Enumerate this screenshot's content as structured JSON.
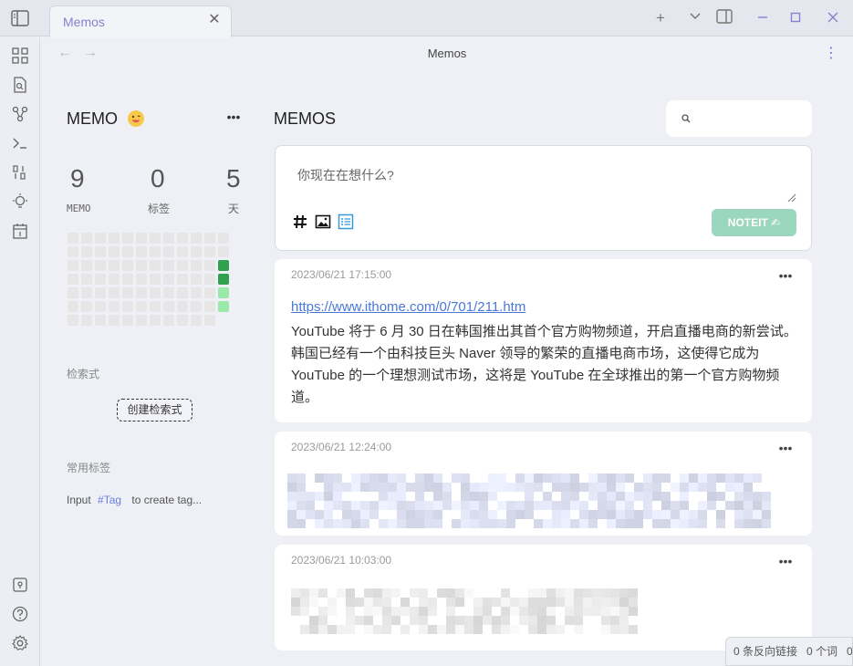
{
  "tab": {
    "title": "Memos",
    "close": "✕"
  },
  "window": {
    "new_tab": "+",
    "dropdown": "⌄",
    "minimize": "—",
    "maximize": "☐",
    "close": "✕"
  },
  "view": {
    "title": "Memos",
    "back": "←",
    "forward": "→",
    "more": "⋮"
  },
  "left_panel": {
    "title": "MEMO",
    "more": "•••",
    "stats": [
      {
        "value": "9",
        "label": "MEMO"
      },
      {
        "value": "0",
        "label": "标签"
      },
      {
        "value": "5",
        "label": "天"
      }
    ],
    "query_section_label": "检索式",
    "create_query_label": "创建检索式",
    "tags_section_label": "常用标签",
    "tag_hint_prefix": "Input",
    "tag_hint_tag": "#Tag",
    "tag_hint_suffix": "to create tag..."
  },
  "main": {
    "title": "MEMOS",
    "editor_placeholder": "你现在在想什么?",
    "noteit_label": "NOTEIT ✍",
    "cards": [
      {
        "time": "2023/06/21 17:15:00",
        "more": "•••",
        "link": "https://www.ithome.com/0/701/211.htm",
        "body": "YouTube 将于 6 月 30 日在韩国推出其首个官方购物频道，开启直播电商的新尝试。韩国已经有一个由科技巨头 Naver 领导的繁荣的直播电商市场，这使得它成为 YouTube 的一个理想测试市场，这将是 YouTube 在全球推出的第一个官方购物频道。"
      },
      {
        "time": "2023/06/21 12:24:00",
        "more": "•••"
      },
      {
        "time": "2023/06/21 10:03:00",
        "more": "•••"
      }
    ]
  },
  "status_bar": {
    "backlinks": "0 条反向链接",
    "words": "0 个词",
    "chars": "0"
  },
  "colors": {
    "accent": "#8a7fd0",
    "noteit_bg": "#9bd6be",
    "link": "#4a78d8",
    "heat_dark": "#30a14e",
    "heat_light": "#9be9a8"
  }
}
